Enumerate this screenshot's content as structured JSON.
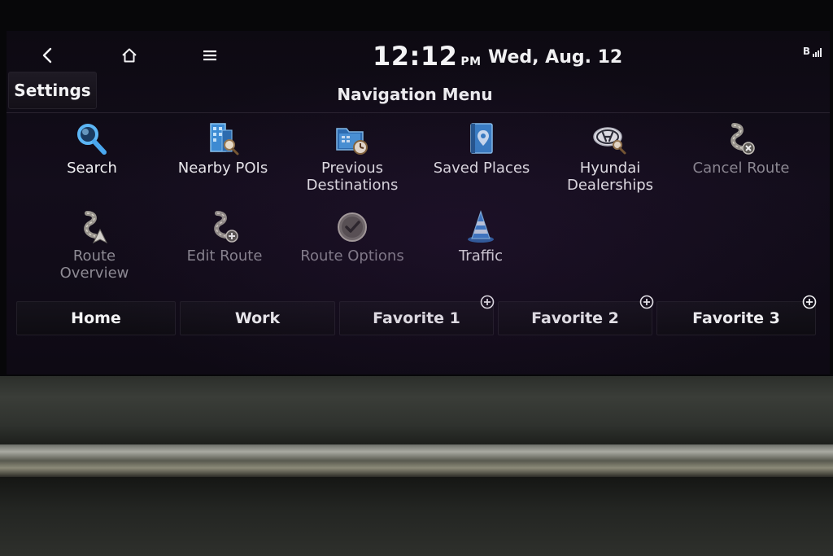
{
  "status_bar": {
    "back_icon": "chevron-left-icon",
    "home_icon": "home-icon",
    "menu_icon": "hamburger-menu-icon",
    "time": "12:12",
    "ampm": "PM",
    "date": "Wed, Aug. 12",
    "bluetooth_label": "B",
    "signal_icon": "signal-strength-icon"
  },
  "header": {
    "settings_label": "Settings",
    "title": "Navigation Menu"
  },
  "menu": {
    "items": [
      {
        "label": "Search",
        "icon": "search-icon",
        "enabled": true
      },
      {
        "label": "Nearby POIs",
        "icon": "building-search-icon",
        "enabled": true
      },
      {
        "label_line1": "Previous",
        "label_line2": "Destinations",
        "icon": "folder-clock-icon",
        "enabled": true
      },
      {
        "label": "Saved Places",
        "icon": "map-pin-book-icon",
        "enabled": true
      },
      {
        "label_line1": "Hyundai",
        "label_line2": "Dealerships",
        "icon": "hyundai-logo-search-icon",
        "enabled": true
      },
      {
        "label": "Cancel Route",
        "icon": "route-cancel-icon",
        "enabled": false
      },
      {
        "label_line1": "Route",
        "label_line2": "Overview",
        "icon": "route-overview-icon",
        "enabled": false
      },
      {
        "label": "Edit Route",
        "icon": "route-edit-icon",
        "enabled": false
      },
      {
        "label": "Route Options",
        "icon": "check-circle-icon",
        "enabled": false
      },
      {
        "label": "Traffic",
        "icon": "traffic-cone-icon",
        "enabled": true
      }
    ]
  },
  "favorites": {
    "home": "Home",
    "work": "Work",
    "fav1": "Favorite 1",
    "fav2": "Favorite 2",
    "fav3": "Favorite 3"
  },
  "colors": {
    "screen_bg": "#120d19",
    "text_primary": "#f2f2f4",
    "text_disabled": "#8e8b94",
    "icon_blue": "#4aa8ef"
  }
}
